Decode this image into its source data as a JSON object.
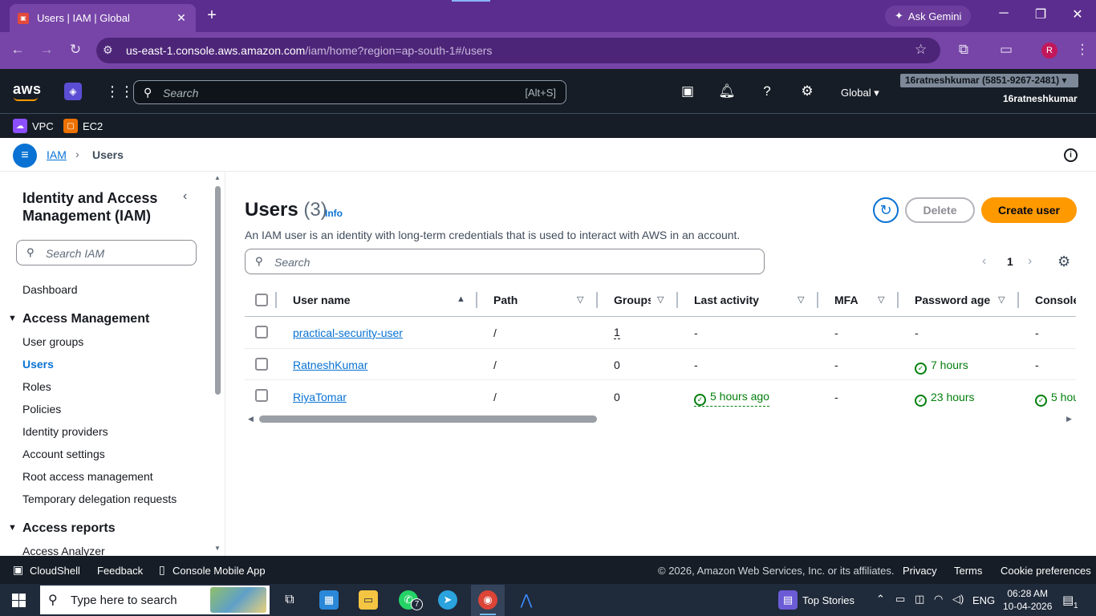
{
  "browser": {
    "tab_title": "Users | IAM | Global",
    "tab_close": "✕",
    "new_tab": "+",
    "ask_gemini": "Ask Gemini",
    "url_host": "us-east-1.console.aws.amazon.com",
    "url_path": "/iam/home?region=ap-south-1#/users",
    "profile_initial": "R"
  },
  "aws_header": {
    "logo": "aws",
    "search_placeholder": "Search",
    "search_shortcut": "[Alt+S]",
    "region": "Global ▾",
    "account_pill": "16ratneshkumar (5851-9267-2481) ▾",
    "account_name": "16ratneshkumar"
  },
  "favorites": [
    {
      "label": "VPC",
      "color": "#8c4fff"
    },
    {
      "label": "EC2",
      "color": "#ed7100"
    }
  ],
  "breadcrumb": {
    "root": "IAM",
    "separator": "›",
    "current": "Users"
  },
  "sidenav": {
    "title": "Identity and Access Management (IAM)",
    "search_placeholder": "Search IAM",
    "dashboard": "Dashboard",
    "section_access_management": "Access Management",
    "access_items": [
      "User groups",
      "Users",
      "Roles",
      "Policies",
      "Identity providers",
      "Account settings",
      "Root access management",
      "Temporary delegation requests"
    ],
    "active_item": "Users",
    "section_access_reports": "Access reports",
    "report_items": [
      "Access Analyzer"
    ]
  },
  "main": {
    "heading": "Users",
    "count": "(3)",
    "info": "Info",
    "description": "An IAM user is an identity with long-term credentials that is used to interact with AWS in an account.",
    "delete_label": "Delete",
    "create_label": "Create user",
    "search_placeholder": "Search",
    "page_number": "1"
  },
  "table": {
    "columns": [
      "User name",
      "Path",
      "Groups",
      "Last activity",
      "MFA",
      "Password age",
      "Console"
    ],
    "rows": [
      {
        "user": "practical-security-user",
        "path": "/",
        "groups": "1",
        "last_activity": "-",
        "mfa": "-",
        "password_age": "-",
        "console": "-"
      },
      {
        "user": "RatneshKumar",
        "path": "/",
        "groups": "0",
        "last_activity": "-",
        "mfa": "-",
        "password_age": "7 hours",
        "console": "-"
      },
      {
        "user": "RiyaTomar",
        "path": "/",
        "groups": "0",
        "last_activity": "5 hours ago",
        "mfa": "-",
        "password_age": "23 hours",
        "console": "5 hou"
      }
    ]
  },
  "footer": {
    "cloudshell": "CloudShell",
    "feedback": "Feedback",
    "mobile_app": "Console Mobile App",
    "copyright": "© 2026, Amazon Web Services, Inc. or its affiliates.",
    "privacy": "Privacy",
    "terms": "Terms",
    "cookies": "Cookie preferences"
  },
  "taskbar": {
    "search_placeholder": "Type here to search",
    "whatsapp_badge": "7",
    "top_stories": "Top Stories",
    "lang": "ENG",
    "time": "06:28 AM",
    "date": "10-04-2026",
    "notif_count": "1"
  },
  "colors": {
    "accent_blue": "#0972d3",
    "primary_orange": "#ff9900",
    "success_green": "#037f0c",
    "aws_dark": "#161d26",
    "chrome_purple": "#7745a8"
  }
}
